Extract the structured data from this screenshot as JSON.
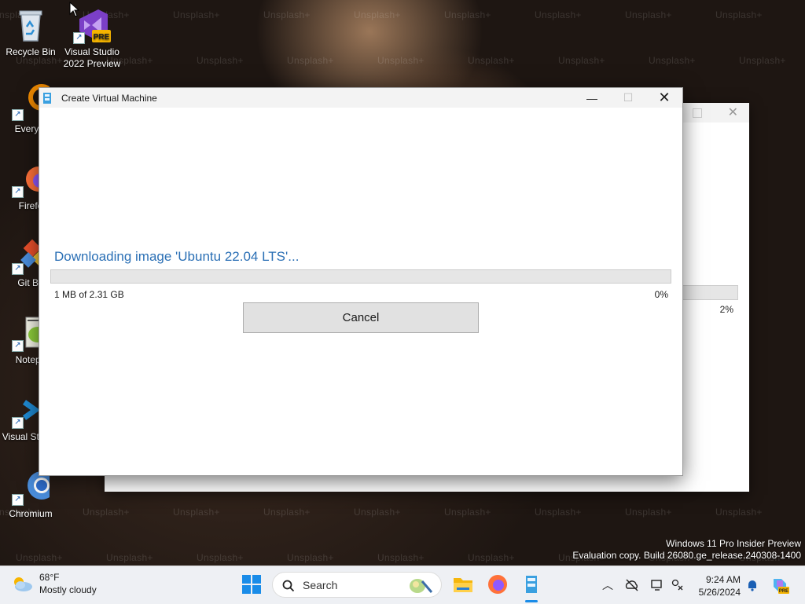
{
  "desktop": {
    "watermark_text": "Unsplash+",
    "icons": [
      {
        "label": "Recycle Bin"
      },
      {
        "label": "Visual Studio 2022 Preview",
        "badge": "PRE"
      },
      {
        "label": "Everyth"
      },
      {
        "label": "Firefo"
      },
      {
        "label": "Git Ba"
      },
      {
        "label": "Notepa"
      },
      {
        "label": "Visual St Cod"
      },
      {
        "label": "Chromium"
      }
    ]
  },
  "background_window": {
    "percent": "2%"
  },
  "dialog": {
    "title": "Create Virtual Machine",
    "status": "Downloading image 'Ubuntu 22.04 LTS'...",
    "progress_size": "1 MB of 2.31 GB",
    "progress_percent": "0%",
    "progress_value": 0.0,
    "cancel_label": "Cancel",
    "minimize_glyph": "—",
    "maximize_glyph": "☐",
    "close_glyph": "✕"
  },
  "os_watermark": {
    "line1": "Windows 11 Pro Insider Preview",
    "line2": "Evaluation copy. Build 26080.ge_release.240308-1400"
  },
  "taskbar": {
    "weather_temp": "68°F",
    "weather_desc": "Mostly cloudy",
    "search_placeholder": "Search",
    "time": "9:24 AM",
    "date": "5/26/2024",
    "copilot_badge": "PRE"
  },
  "colors": {
    "accent_blue": "#2a6fb5",
    "progress_green": "#06b025",
    "taskbar_bg": "#eef0f4"
  }
}
